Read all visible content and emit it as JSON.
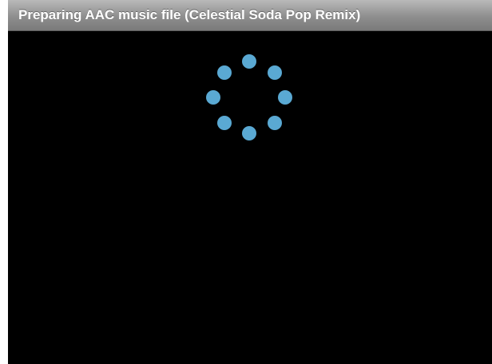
{
  "window": {
    "title": "Preparing AAC music file (Celestial Soda Pop Remix)"
  },
  "loading_indicator": {
    "dot_count": 8,
    "dot_color": "#5aa9d3",
    "background_color": "#000000"
  }
}
